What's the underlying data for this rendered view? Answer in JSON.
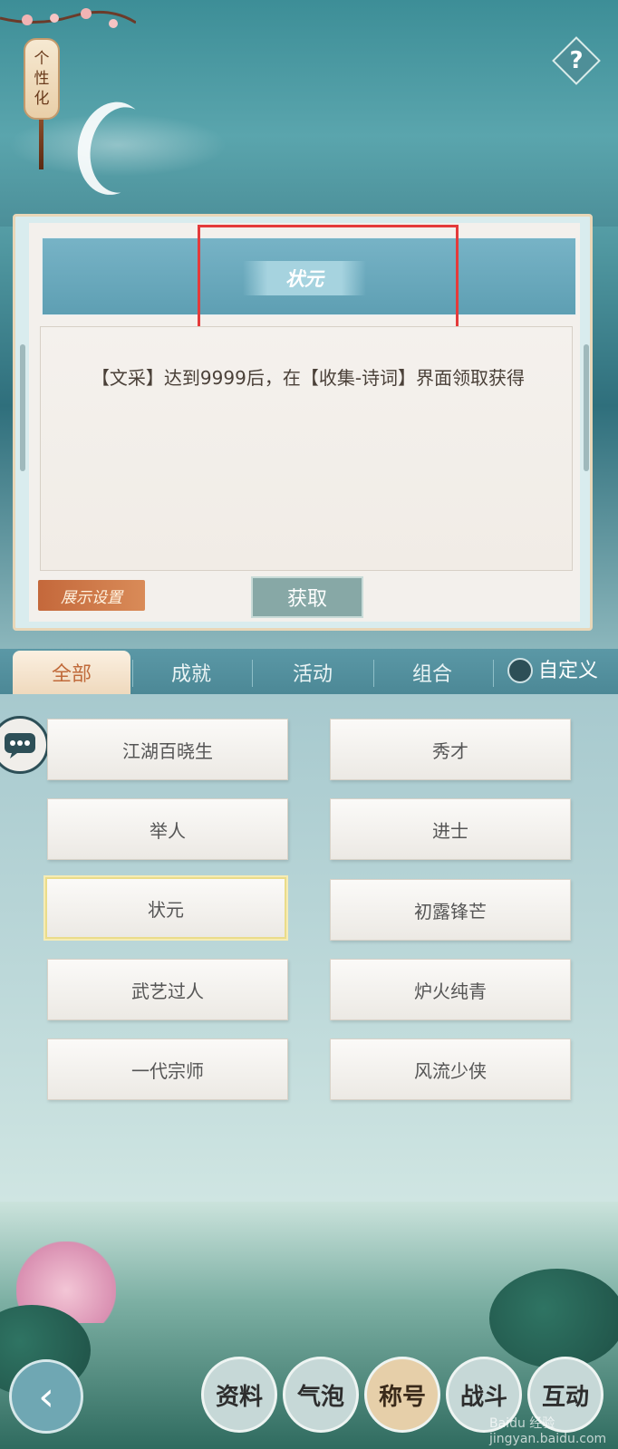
{
  "header": {
    "lantern_label": "个\n性\n化",
    "help_label": "?"
  },
  "detail": {
    "title": "状元",
    "description": "【文采】达到9999后，在【收集-诗词】界面领取获得",
    "display_settings_label": "展示设置",
    "obtain_label": "获取"
  },
  "tabs": [
    {
      "label": "全部",
      "active": true
    },
    {
      "label": "成就",
      "active": false
    },
    {
      "label": "活动",
      "active": false
    },
    {
      "label": "组合",
      "active": false
    }
  ],
  "custom_label": "自定义",
  "titles": [
    {
      "label": "江湖百晓生"
    },
    {
      "label": "秀才"
    },
    {
      "label": "举人"
    },
    {
      "label": "进士"
    },
    {
      "label": "状元",
      "selected": true
    },
    {
      "label": "初露锋芒"
    },
    {
      "label": "武艺过人"
    },
    {
      "label": "炉火纯青"
    },
    {
      "label": "一代宗师"
    },
    {
      "label": "风流少侠"
    }
  ],
  "bottom_nav": [
    {
      "label": "资料"
    },
    {
      "label": "气泡"
    },
    {
      "label": "称号",
      "active": true
    },
    {
      "label": "战斗"
    },
    {
      "label": "互动"
    }
  ],
  "watermark": "Baidu 经验 jingyan.baidu.com",
  "colors": {
    "accent_orange": "#c06a3a",
    "highlight_red": "#e43b3b",
    "title_band": "#6aa9bc"
  }
}
